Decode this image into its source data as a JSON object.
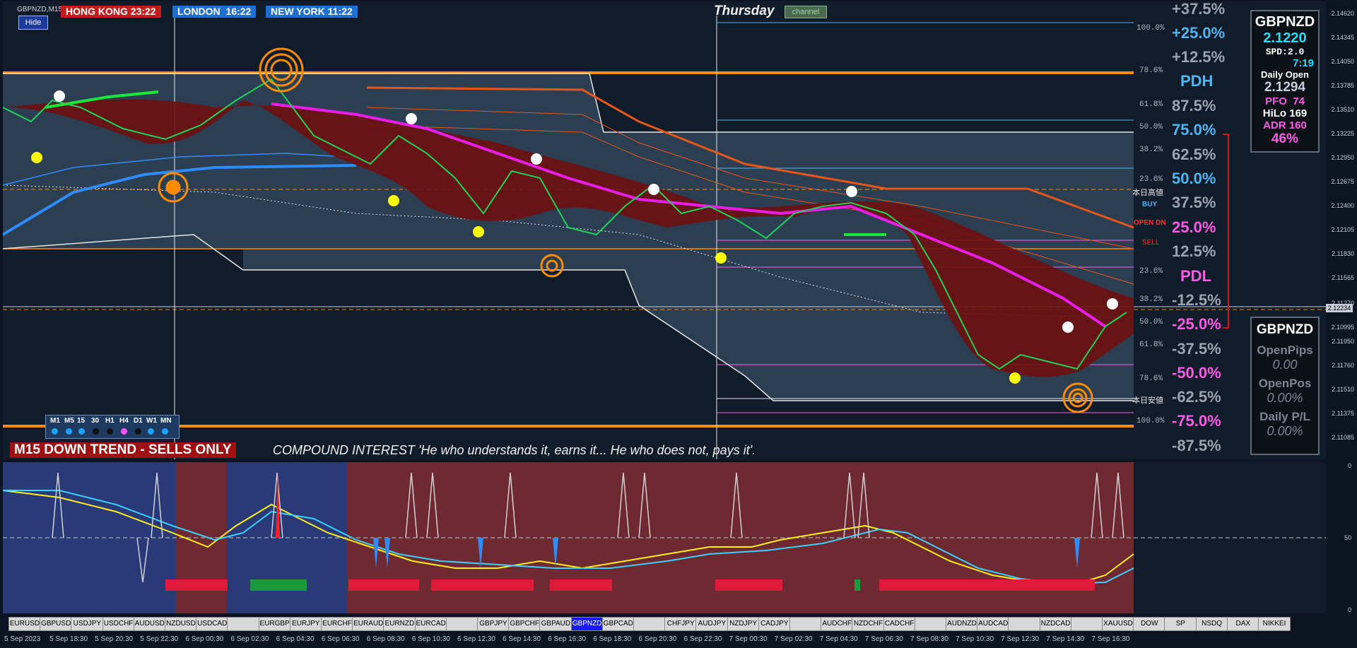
{
  "chart": {
    "symbol_tf": "GBPNZD,M15",
    "day": "Thursday",
    "channel_button": "channel",
    "hide_button": "Hide"
  },
  "sessions": [
    {
      "label": "HONG KONG",
      "time": "23:22",
      "color": "#c21d1d"
    },
    {
      "label": "LONDON",
      "time": "16:22",
      "color": "#1f6fd1"
    },
    {
      "label": "NEW YORK",
      "time": "11:22",
      "color": "#1f6fd1"
    }
  ],
  "fib_levels_left": [
    "100.0%",
    "78.6%",
    "61.8%",
    "50.0%",
    "38.2%",
    "23.6%",
    "23.6%",
    "38.2%",
    "50.0%",
    "61.8%",
    "78.6%",
    "100.0%"
  ],
  "pct_levels": [
    {
      "text": "+37.5%",
      "color": "#9aa4ae"
    },
    {
      "text": "+25.0%",
      "color": "#4fb4f0"
    },
    {
      "text": "+12.5%",
      "color": "#9aa4ae"
    },
    {
      "text": "PDH",
      "color": "#4fb4f0"
    },
    {
      "text": "87.5%",
      "color": "#9aa4ae"
    },
    {
      "text": "75.0%",
      "color": "#4fb4f0"
    },
    {
      "text": "62.5%",
      "color": "#9aa4ae"
    },
    {
      "text": "50.0%",
      "color": "#4fb4f0"
    },
    {
      "text": "37.5%",
      "color": "#9aa4ae"
    },
    {
      "text": "25.0%",
      "color": "#ff5ce6"
    },
    {
      "text": "12.5%",
      "color": "#9aa4ae"
    },
    {
      "text": "PDL",
      "color": "#ff5ce6"
    },
    {
      "text": "-12.5%",
      "color": "#9aa4ae"
    },
    {
      "text": "-25.0%",
      "color": "#ff5ce6"
    },
    {
      "text": "-37.5%",
      "color": "#9aa4ae"
    },
    {
      "text": "-50.0%",
      "color": "#ff5ce6"
    },
    {
      "text": "-62.5%",
      "color": "#9aa4ae"
    },
    {
      "text": "-75.0%",
      "color": "#ff5ce6"
    },
    {
      "text": "-87.5%",
      "color": "#9aa4ae"
    }
  ],
  "side_labels": {
    "day_high": "本日高値",
    "buy": "BUY",
    "open_dn": "OPEN DN",
    "sell": "SELL",
    "day_low": "本日安値"
  },
  "price_axis": [
    "2.14620",
    "2.14345",
    "2.14050",
    "2.13785",
    "2.13510",
    "2.13225",
    "2.12950",
    "2.12675",
    "2.12400",
    "2.12105",
    "2.11830",
    "2.11565",
    "2.11270",
    "2.10995",
    "2.11950",
    "2.11760",
    "2.11510",
    "2.11375",
    "2.11085"
  ],
  "current_price_label": "2.12234",
  "info_panel": {
    "symbol": "GBPNZD",
    "price": "2.1220",
    "spread": "SPD:2.0",
    "countdown": "7:19",
    "daily_open_label": "Daily Open",
    "daily_open": "2.1294",
    "pfo_label": "PFO",
    "pfo": "74",
    "hilo_label": "HiLo",
    "hilo": "169",
    "adr_label": "ADR",
    "adr": "160",
    "adr_pct": "46%"
  },
  "pnl_panel": {
    "symbol": "GBPNZD",
    "open_pips_label": "OpenPips",
    "open_pips": "0.00",
    "open_pos_label": "OpenPos",
    "open_pos": "0.00%",
    "daily_pl_label": "Daily P/L",
    "daily_pl": "0.00%"
  },
  "trend_banner": "M15  DOWN TREND - SELLS ONLY",
  "quote": "COMPOUND INTEREST  'He who understands it, earns it... He who does not, pays it'.",
  "timeframes": [
    "M1",
    "M5",
    "15",
    "30",
    "H1",
    "H4",
    "D1",
    "W1",
    "MN"
  ],
  "timeframe_dot_colors": [
    "#1aa3ff",
    "#1aa3ff",
    "#1aa3ff",
    "#111",
    "#111",
    "#ff55ff",
    "#111",
    "#1aa3ff",
    "#1aa3ff"
  ],
  "symbols": [
    "EURUSD",
    "GBPUSD",
    "USDJPY",
    "USDCHF",
    "AUDUSD",
    "NZDUSD",
    "USDCAD",
    "",
    "EURGBP",
    "EURJPY",
    "EURCHF",
    "EURAUD",
    "EURNZD",
    "EURCAD",
    "",
    "GBPJPY",
    "GBPCHF",
    "GBPAUD",
    "GBPNZD",
    "GBPCAD",
    "",
    "CHFJPY",
    "AUDJPY",
    "NZDJPY",
    "CADJPY",
    "",
    "AUDCHF",
    "NZDCHF",
    "CADCHF",
    "",
    "AUDNZD",
    "AUDCAD",
    "",
    "NZDCAD",
    "",
    "XAUUSD",
    "DOW",
    "SP",
    "NSDQ",
    "DAX",
    "NIKKEI"
  ],
  "active_symbol": "GBPNZD",
  "time_axis": [
    "5 Sep 2023",
    "5 Sep 18:30",
    "5 Sep 20:30",
    "5 Sep 22:30",
    "6 Sep 00:30",
    "6 Sep 02:30",
    "6 Sep 04:30",
    "6 Sep 06:30",
    "6 Sep 08:30",
    "6 Sep 10:30",
    "6 Sep 12:30",
    "6 Sep 14:30",
    "6 Sep 16:30",
    "6 Sep 18:30",
    "6 Sep 20:30",
    "6 Sep 22:30",
    "7 Sep 00:30",
    "7 Sep 02:30",
    "7 Sep 04:30",
    "7 Sep 06:30",
    "7 Sep 08:30",
    "7 Sep 10:30",
    "7 Sep 12:30",
    "7 Sep 14:30",
    "7 Sep 16:30"
  ],
  "sub_axis": [
    "0",
    "50",
    "0"
  ],
  "colors": {
    "bull": "#19d85a",
    "bear": "#d35a12",
    "ma_magenta": "#e81ee8",
    "level_orange": "#ff8c00",
    "sub_bg_blue": "#2a3a78",
    "sub_bg_red": "#6e2a30"
  }
}
